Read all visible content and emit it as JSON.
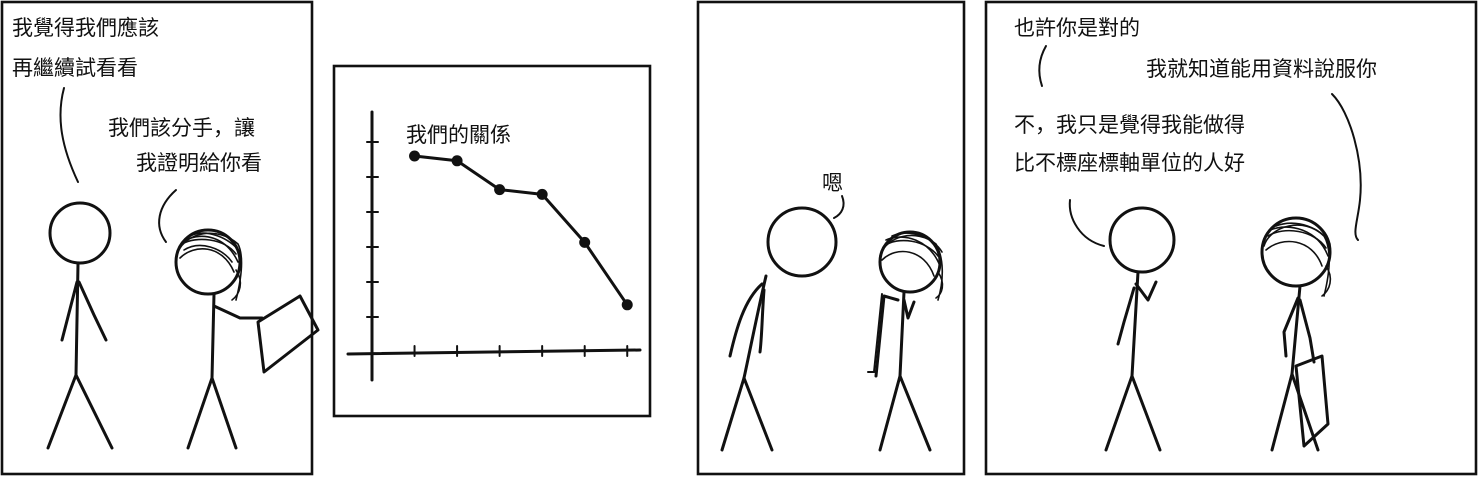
{
  "panel1": {
    "speech_left": [
      "我覺得我們應該",
      "再繼續試看看"
    ],
    "speech_right": [
      "我們該分手，讓",
      "我證明給你看"
    ]
  },
  "panel2": {
    "chart_data": {
      "type": "line",
      "title": "我們的關係",
      "xlabel": "",
      "ylabel": "",
      "series": [
        {
          "values": [
            8,
            7.8,
            6.6,
            6.4,
            4.4,
            1.8
          ]
        }
      ],
      "x": [
        1,
        2,
        3,
        4,
        5,
        6
      ],
      "ylim": [
        0,
        10
      ],
      "grid": false
    }
  },
  "panel3": {
    "speech": "嗯"
  },
  "panel4": {
    "speech_top_left": "也許你是對的",
    "speech_top_right": "我就知道能用資料說服你",
    "speech_left": [
      "不，我只是覺得我能做得",
      "比不標座標軸單位的人好"
    ]
  }
}
